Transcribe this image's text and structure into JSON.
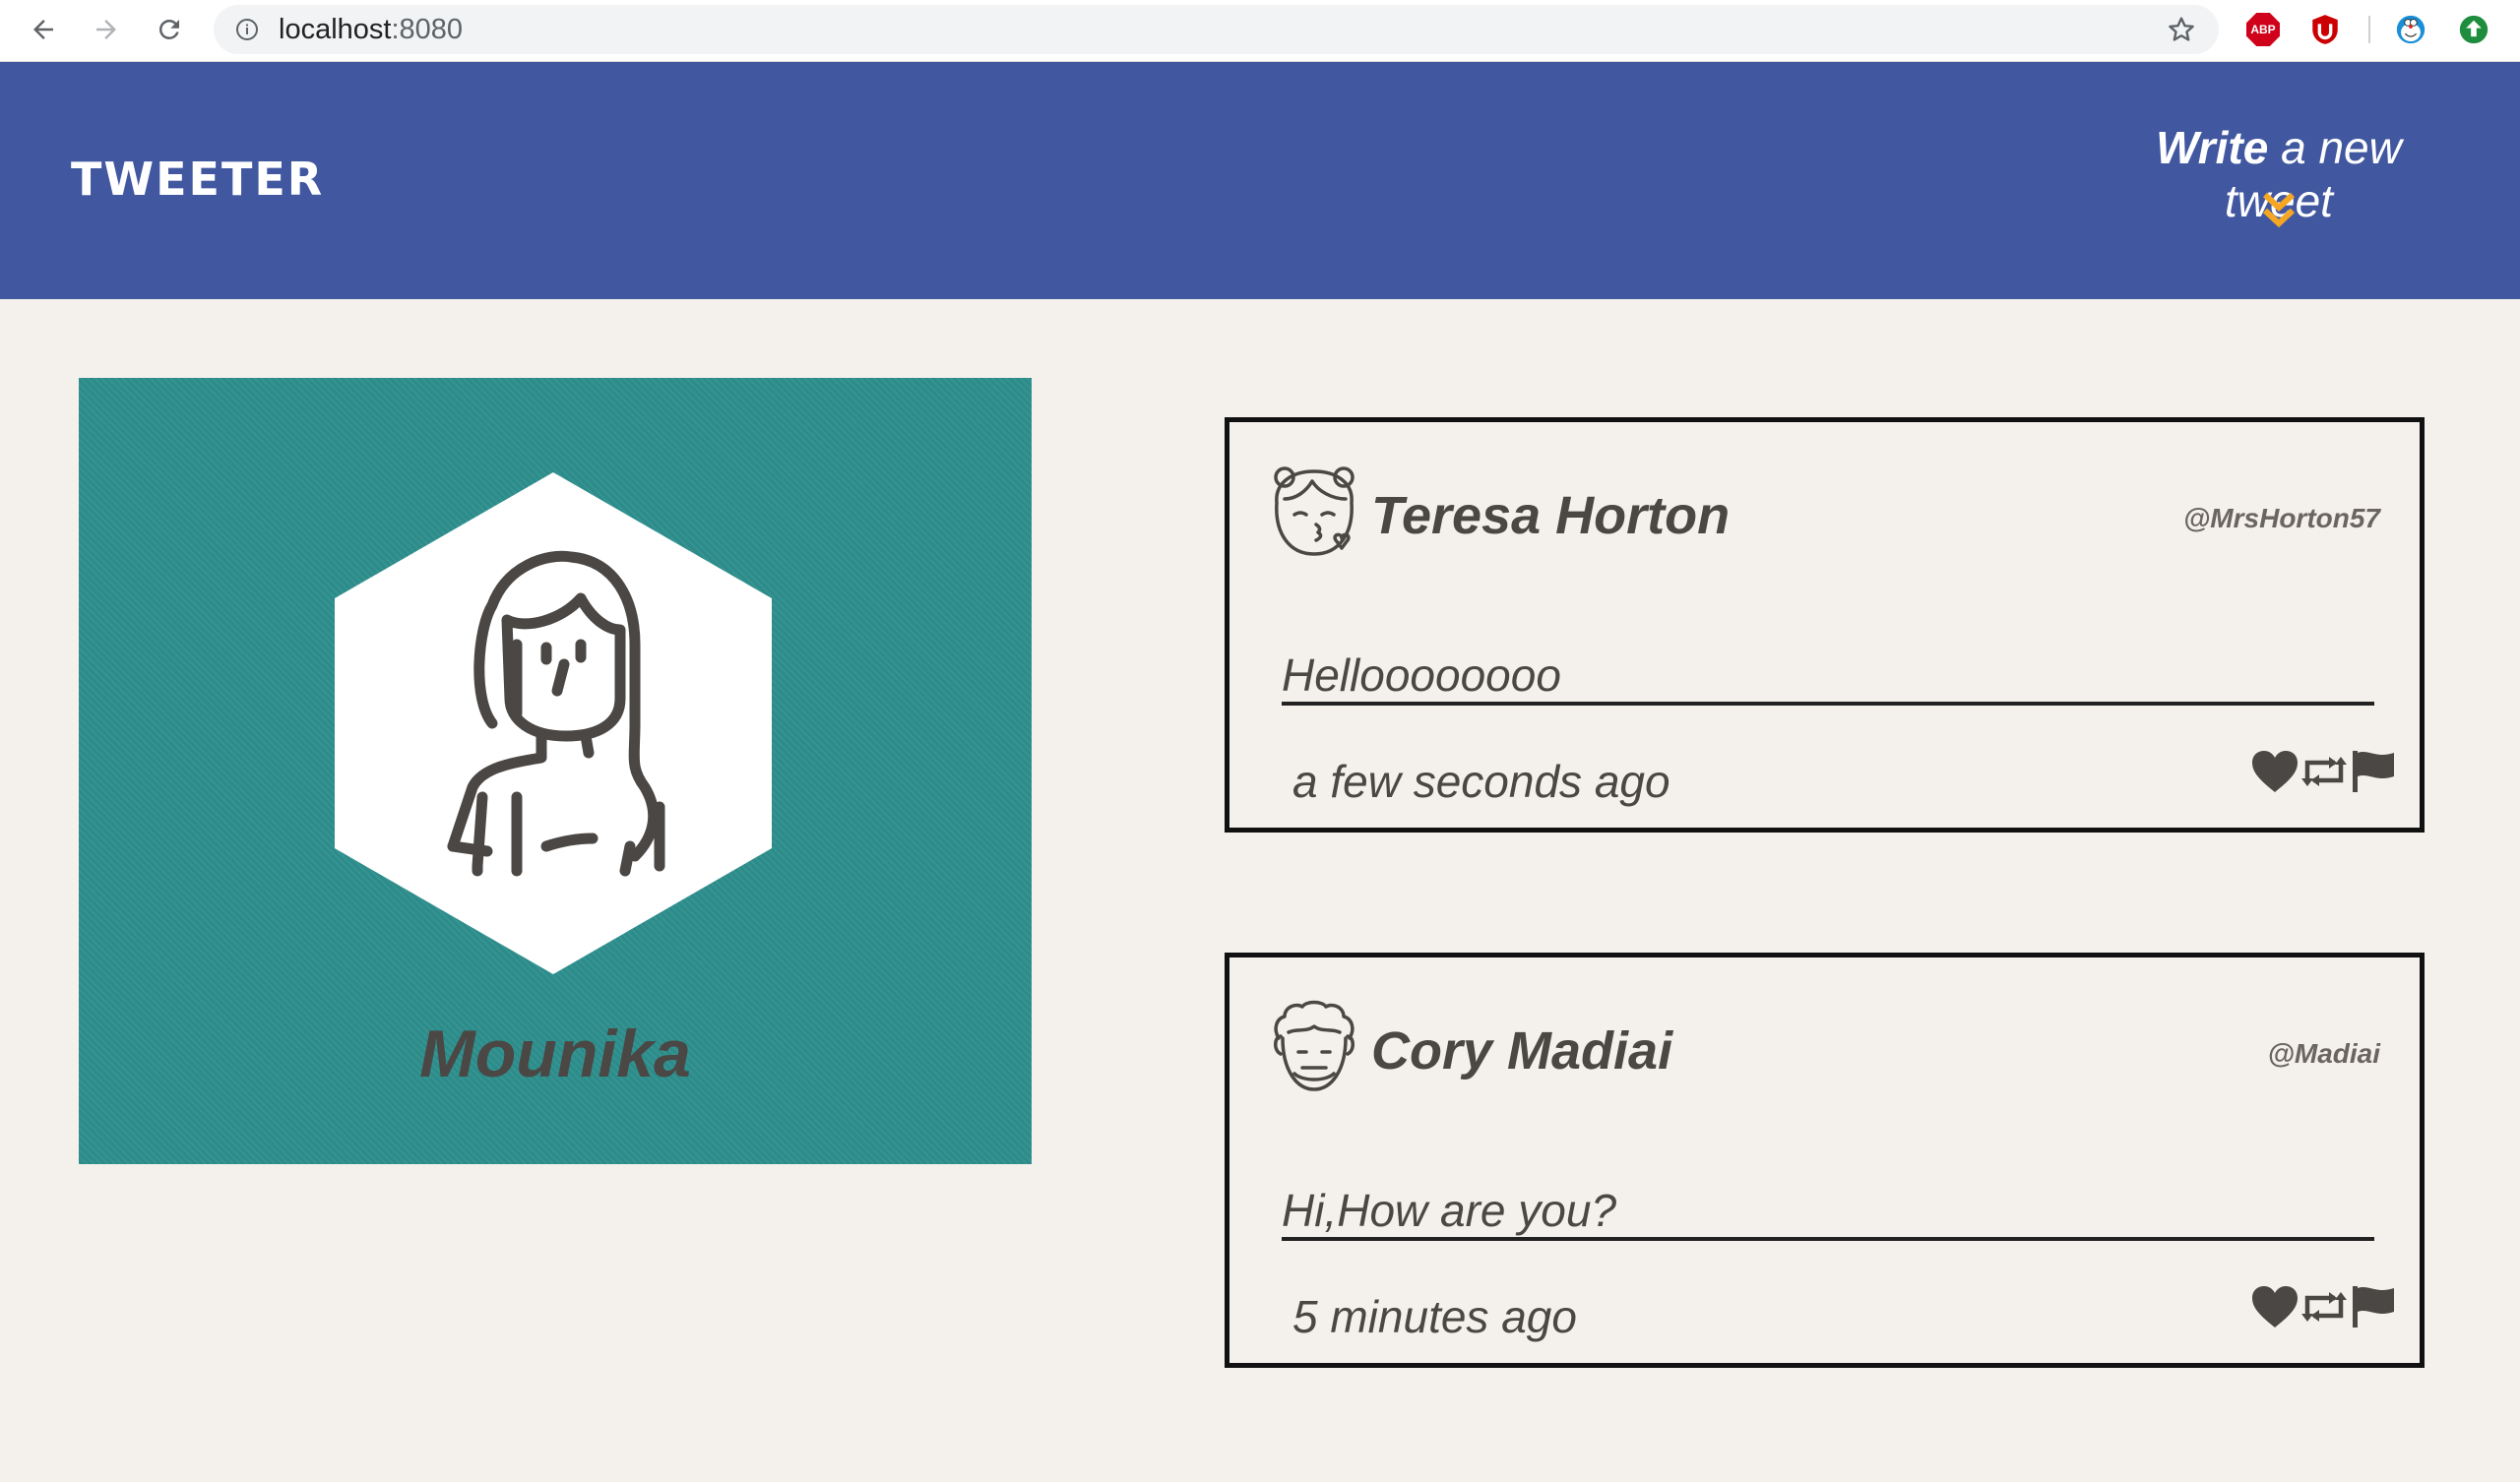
{
  "browser": {
    "url_host": "localhost",
    "url_port": ":8080",
    "icons": [
      "back-arrow-icon",
      "forward-arrow-icon",
      "reload-icon",
      "info-icon",
      "star-icon",
      "adblock-icon",
      "ublock-icon",
      "doraemon-icon",
      "update-icon"
    ]
  },
  "header": {
    "brand": "TWEETER",
    "compose_bold": "Write",
    "compose_rest": " a new tweet",
    "accent": "#f5a623",
    "background": "#4158a0"
  },
  "profile": {
    "name": "Mounika",
    "background": "#2e908e"
  },
  "tweets": [
    {
      "name": "Teresa Horton",
      "handle": "@MrsHorton57",
      "text": "Helloooooooo",
      "time": "a few seconds ago"
    },
    {
      "name": "Cory Madiai",
      "handle": "@Madiai",
      "text": "Hi,How are you?",
      "time": "5 minutes ago"
    }
  ],
  "tweet_actions": [
    "heart-icon",
    "retweet-icon",
    "flag-icon"
  ]
}
